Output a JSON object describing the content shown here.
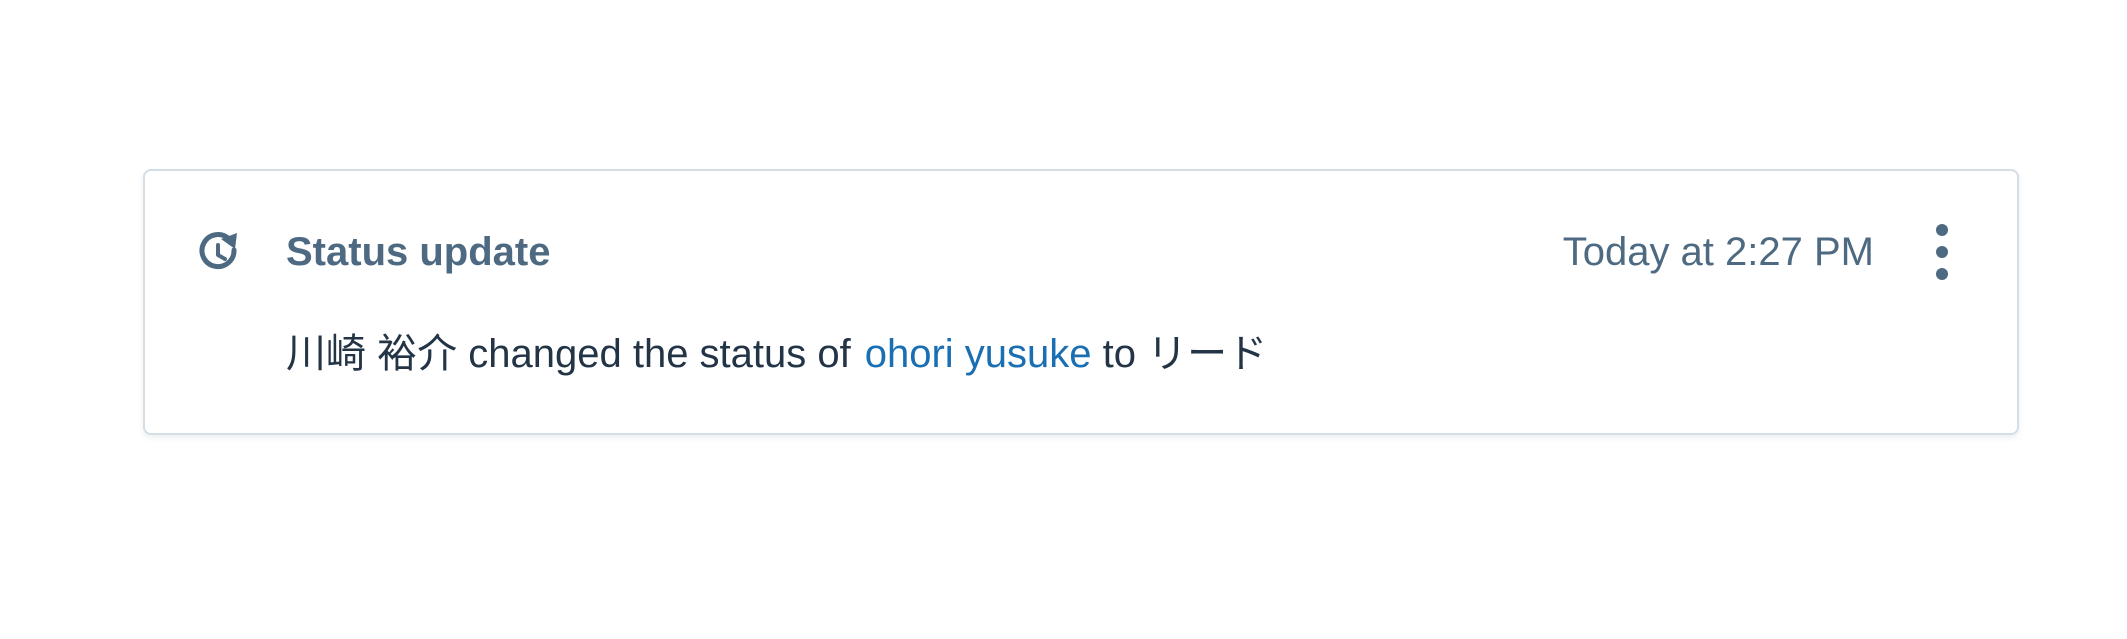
{
  "activity": {
    "icon": "history-clock-icon",
    "title": "Status update",
    "timestamp": "Today at 2:27 PM",
    "more_icon": "more-vertical-icon",
    "message": {
      "actor": "川崎 裕介",
      "action": "changed the status of",
      "target": "ohori yusuke",
      "connector": "to",
      "new_status": "リード"
    }
  },
  "colors": {
    "heading": "#4e6a82",
    "body_text": "#233446",
    "link": "#1a6fb3",
    "border": "#d3dee6"
  }
}
